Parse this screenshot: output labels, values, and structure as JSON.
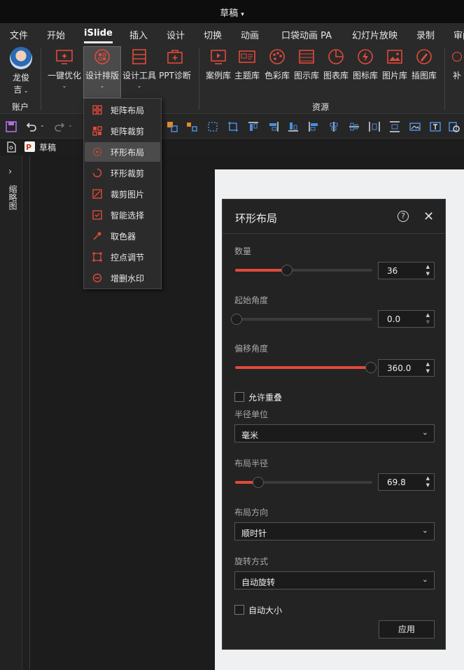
{
  "titlebar": {
    "title": "草稿"
  },
  "menu_tabs": [
    "文件",
    "开始",
    "iSlide",
    "插入",
    "设计",
    "切换",
    "动画",
    "口袋动画 PA",
    "幻灯片放映",
    "录制",
    "审阅"
  ],
  "active_tab": "iSlide",
  "ribbon": {
    "account": {
      "name_line1": "龙俊",
      "name_line2": "吉",
      "group": "账户"
    },
    "buttons": [
      {
        "label": "一键优化",
        "icon": "monitor-sparkle-icon"
      },
      {
        "label": "设计排版",
        "icon": "layout-grid-icon"
      },
      {
        "label": "设计工具",
        "icon": "toolbox-icon"
      },
      {
        "label": "PPT诊断",
        "icon": "medkit-icon"
      }
    ],
    "resources": [
      {
        "label": "案例库",
        "icon": "case-icon"
      },
      {
        "label": "主题库",
        "icon": "theme-icon"
      },
      {
        "label": "色彩库",
        "icon": "palette-icon"
      },
      {
        "label": "图示库",
        "icon": "diagram-icon"
      },
      {
        "label": "图表库",
        "icon": "piechart-icon"
      },
      {
        "label": "图标库",
        "icon": "icon-library-icon"
      },
      {
        "label": "图片库",
        "icon": "image-icon"
      },
      {
        "label": "插图库",
        "icon": "illustration-icon"
      }
    ],
    "resources_group": "资源",
    "more_label": "补"
  },
  "slide_tab": {
    "title": "草稿"
  },
  "side_panel_label": "缩略图",
  "dropdown": {
    "items": [
      {
        "label": "矩阵布局",
        "icon": "matrix-layout-icon"
      },
      {
        "label": "矩阵裁剪",
        "icon": "matrix-crop-icon"
      },
      {
        "label": "环形布局",
        "icon": "ring-layout-icon"
      },
      {
        "label": "环形裁剪",
        "icon": "ring-crop-icon"
      },
      {
        "label": "裁剪图片",
        "icon": "crop-image-icon"
      },
      {
        "label": "智能选择",
        "icon": "smart-select-icon"
      },
      {
        "label": "取色器",
        "icon": "eyedropper-icon"
      },
      {
        "label": "控点调节",
        "icon": "handle-adjust-icon"
      },
      {
        "label": "增删水印",
        "icon": "watermark-icon"
      }
    ],
    "selected": "环形布局"
  },
  "dialog": {
    "title": "环形布局",
    "help": "?",
    "quantity": {
      "label": "数量",
      "value": "36",
      "fraction": 0.38
    },
    "start_angle": {
      "label": "起始角度",
      "value": "0.0",
      "fraction": 0.0
    },
    "offset_angle": {
      "label": "偏移角度",
      "value": "360.0",
      "fraction": 1.0
    },
    "allow_overlap": {
      "label": "允许重叠",
      "checked": false
    },
    "radius_unit": {
      "label": "半径单位",
      "value": "毫米"
    },
    "layout_radius": {
      "label": "布局半径",
      "value": "69.8",
      "fraction": 0.17
    },
    "layout_direction": {
      "label": "布局方向",
      "value": "顺时针"
    },
    "rotation_mode": {
      "label": "旋转方式",
      "value": "自动旋转"
    },
    "auto_size": {
      "label": "自动大小",
      "checked": false
    },
    "apply_label": "应用"
  },
  "colors": {
    "accent": "#e04a3a",
    "background": "#1f1f1f",
    "dialog": "#232323"
  }
}
